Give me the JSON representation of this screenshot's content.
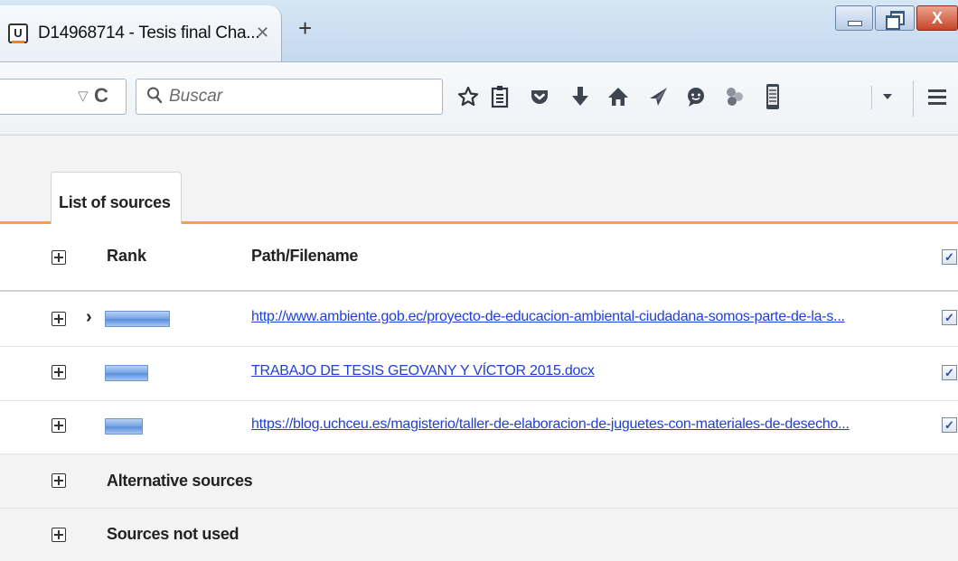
{
  "tab": {
    "title": "D14968714 - Tesis final Cha...",
    "favicon_letter": "U",
    "close_glyph": "✕",
    "new_tab_glyph": "+"
  },
  "window_controls": {
    "close_glyph": "X"
  },
  "navbar": {
    "dropdown_glyph": "▽",
    "reload_glyph": "C",
    "search_placeholder": "Buscar",
    "icons": [
      "bookmark-star-icon",
      "reading-list-icon",
      "pocket-icon",
      "download-icon",
      "home-icon",
      "send-icon",
      "chat-icon",
      "extension-icon",
      "phone-icon",
      "dropdown-arrow-icon",
      "menu-icon"
    ]
  },
  "panel": {
    "tab_label": "List of sources"
  },
  "table": {
    "headers": {
      "rank": "Rank",
      "path": "Path/Filename"
    },
    "rows": [
      {
        "selected_marker": "›",
        "rank_fraction": 0.72,
        "path": "http://www.ambiente.gob.ec/proyecto-de-educacion-ambiental-ciudadana-somos-parte-de-la-s...",
        "checked": true
      },
      {
        "selected_marker": "",
        "rank_fraction": 0.48,
        "path": "TRABAJO DE TESIS GEOVANY Y VÍCTOR 2015.docx",
        "checked": true
      },
      {
        "selected_marker": "",
        "rank_fraction": 0.42,
        "path": "https://blog.uchceu.es/magisterio/taller-de-elaboracion-de-juguetes-con-materiales-de-desecho...",
        "checked": true
      }
    ],
    "groups": [
      "Alternative sources",
      "Sources not used"
    ],
    "check_glyph": "✓"
  },
  "colors": {
    "accent_orange": "#f2a04a",
    "link_blue": "#1f3fd6",
    "rank_bar_blue": "#5b8fdc"
  }
}
